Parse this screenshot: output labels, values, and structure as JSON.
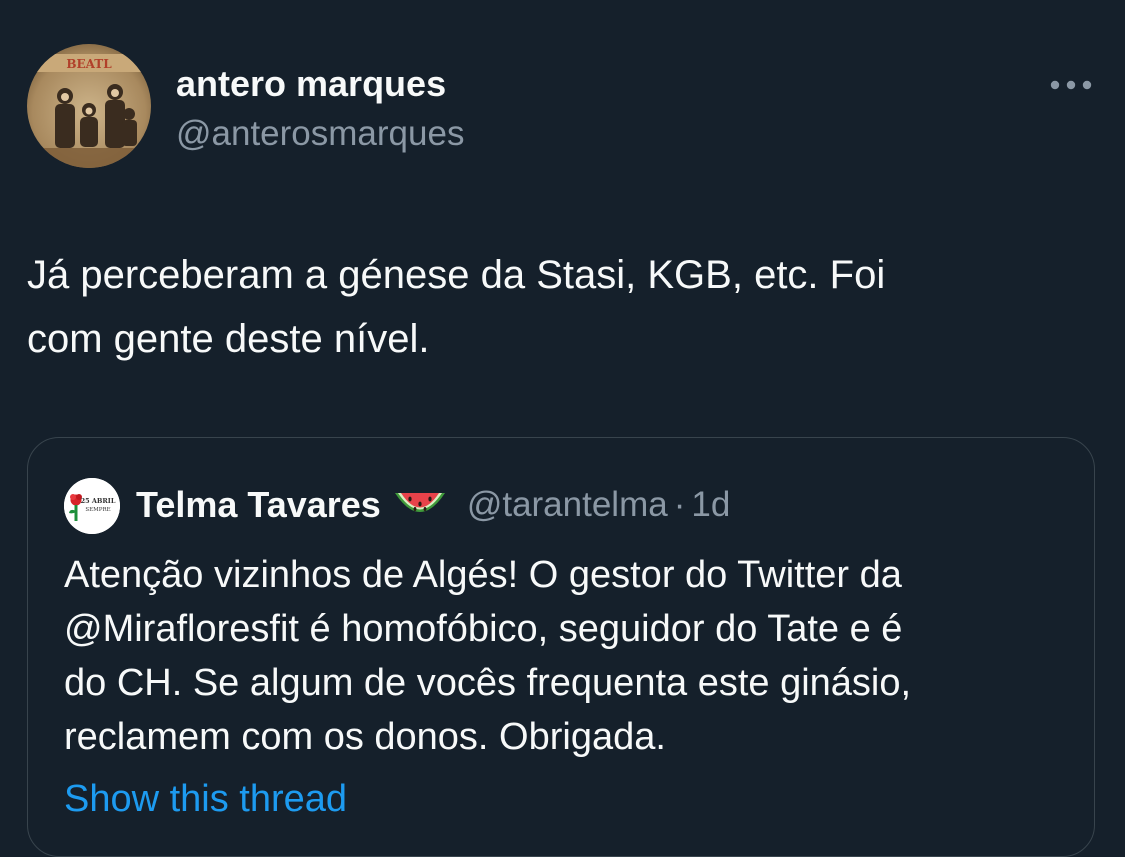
{
  "author": {
    "display_name": "antero marques",
    "handle": "@anterosmarques",
    "avatar_caption": "BEATL"
  },
  "tweet": {
    "text_lines": [
      "Já perceberam a génese da Stasi, KGB, etc. Foi",
      "com gente deste nível."
    ]
  },
  "quoted": {
    "display_name": "Telma Tavares",
    "emoji": "watermelon",
    "handle": "@tarantelma",
    "separator": "·",
    "time": "1d",
    "avatar_text_top": "25 ABRIL",
    "avatar_text_bottom": "SEMPRE",
    "text_lines": [
      "Atenção vizinhos de Algés! O gestor do Twitter da",
      "@Mirafloresfit é homofóbico, seguidor do Tate e é",
      "do CH. Se algum de vocês frequenta este ginásio,",
      "reclamem com os donos. Obrigada."
    ],
    "show_thread_label": "Show this thread"
  },
  "colors": {
    "background": "#15202b",
    "text": "#f7f9f9",
    "secondary": "#8b98a5",
    "link": "#1d9bf0",
    "border": "#38444d"
  }
}
